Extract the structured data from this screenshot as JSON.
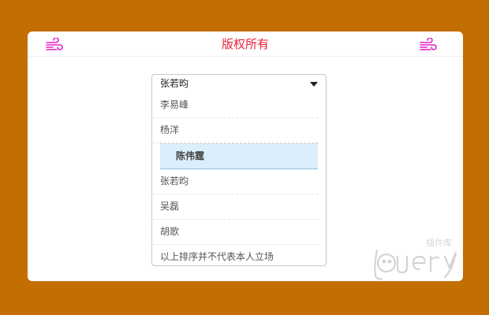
{
  "header": {
    "title": "版权所有",
    "left_icon": "wind-icon",
    "right_icon": "wind-icon",
    "icon_color": "#e020c8",
    "title_color": "#e8203a"
  },
  "select": {
    "current_value": "张若昀",
    "options": [
      {
        "label": "李易峰",
        "selected": false
      },
      {
        "label": "杨洋",
        "selected": false
      },
      {
        "label": "陈伟霆",
        "selected": true
      },
      {
        "label": "张若昀",
        "selected": false
      },
      {
        "label": "吴磊",
        "selected": false
      },
      {
        "label": "胡歌",
        "selected": false
      },
      {
        "label": "以上排序并不代表本人立场",
        "selected": false
      }
    ]
  },
  "watermark": {
    "text": "jQuery",
    "subtext": "插件库"
  },
  "colors": {
    "background": "#c26e00",
    "card": "#ffffff",
    "highlight": "#dbeefb"
  }
}
